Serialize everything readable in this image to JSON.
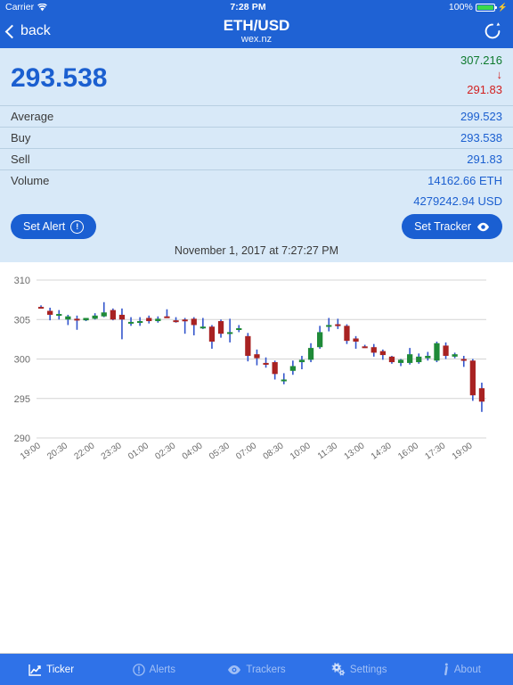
{
  "status_bar": {
    "carrier": "Carrier",
    "wifi_icon": "wifi-icon",
    "time": "7:28 PM",
    "battery_percent": "100%",
    "battery_icon": "battery-icon",
    "charging_icon": "lightning-bolt-icon"
  },
  "nav": {
    "back_label": "back",
    "back_icon": "chevron-left-icon",
    "title": "ETH/USD",
    "subtitle": "wex.nz",
    "refresh_icon": "refresh-icon"
  },
  "ticker": {
    "last_price": "293.538",
    "high": "307.216",
    "trend_icon": "arrow-down-icon",
    "low": "291.83",
    "rows": [
      {
        "label": "Average",
        "value": "299.523"
      },
      {
        "label": "Buy",
        "value": "293.538"
      },
      {
        "label": "Sell",
        "value": "291.83"
      }
    ],
    "volume_label": "Volume",
    "volume_base": "14162.66 ETH",
    "volume_quote": "4279242.94 USD",
    "set_alert_label": "Set Alert",
    "set_alert_icon": "exclamation-circle-icon",
    "set_tracker_label": "Set Tracker",
    "set_tracker_icon": "eye-icon",
    "timestamp": "November 1, 2017 at 7:27:27 PM"
  },
  "colors": {
    "brand_blue": "#1f62d4",
    "tabbar_blue": "#2f72e8",
    "panel_bg": "#d8e9f8",
    "price_blue": "#1b5fd0",
    "high_green": "#0e7a2e",
    "low_red": "#d21f1f",
    "candle_up": "#1f8a38",
    "candle_down": "#a82222",
    "wick_blue": "#3355cc",
    "gridline": "#d4d4d4"
  },
  "chart_data": {
    "type": "candlestick",
    "title": "",
    "xlabel": "",
    "ylabel": "",
    "ylim": [
      290,
      310
    ],
    "yticks": [
      290,
      295,
      300,
      305,
      310
    ],
    "grid": true,
    "legend": "none",
    "xticks": [
      "19:00",
      "20:30",
      "22:00",
      "23:30",
      "01:00",
      "02:30",
      "04:00",
      "05:30",
      "07:00",
      "08:30",
      "10:00",
      "11:30",
      "13:00",
      "14:30",
      "16:00",
      "17:30",
      "19:00"
    ],
    "xtick_every_n_candles": 3,
    "candles": [
      {
        "t": "19:00",
        "o": 306.6,
        "h": 306.8,
        "l": 306.4,
        "c": 306.5,
        "dir": "down"
      },
      {
        "t": "19:30",
        "o": 306.1,
        "h": 306.5,
        "l": 304.9,
        "c": 305.6,
        "dir": "down"
      },
      {
        "t": "20:00",
        "o": 305.5,
        "h": 306.2,
        "l": 305.0,
        "c": 305.7,
        "dir": "up"
      },
      {
        "t": "20:30",
        "o": 305.4,
        "h": 305.6,
        "l": 304.3,
        "c": 305.0,
        "dir": "up"
      },
      {
        "t": "21:00",
        "o": 305.1,
        "h": 305.5,
        "l": 303.7,
        "c": 304.9,
        "dir": "down"
      },
      {
        "t": "21:30",
        "o": 304.9,
        "h": 305.2,
        "l": 304.8,
        "c": 305.2,
        "dir": "up"
      },
      {
        "t": "22:00",
        "o": 305.1,
        "h": 305.8,
        "l": 305.0,
        "c": 305.5,
        "dir": "up"
      },
      {
        "t": "22:30",
        "o": 305.4,
        "h": 307.2,
        "l": 305.3,
        "c": 305.9,
        "dir": "up"
      },
      {
        "t": "23:00",
        "o": 306.2,
        "h": 306.4,
        "l": 304.9,
        "c": 305.0,
        "dir": "down"
      },
      {
        "t": "23:30",
        "o": 305.6,
        "h": 306.4,
        "l": 302.5,
        "c": 305.0,
        "dir": "down"
      },
      {
        "t": "00:00",
        "o": 304.7,
        "h": 305.3,
        "l": 304.2,
        "c": 304.6,
        "dir": "up"
      },
      {
        "t": "00:30",
        "o": 304.7,
        "h": 305.3,
        "l": 304.2,
        "c": 304.8,
        "dir": "up"
      },
      {
        "t": "01:00",
        "o": 305.2,
        "h": 305.5,
        "l": 304.5,
        "c": 304.8,
        "dir": "down"
      },
      {
        "t": "01:30",
        "o": 304.8,
        "h": 305.4,
        "l": 304.6,
        "c": 305.1,
        "dir": "up"
      },
      {
        "t": "02:00",
        "o": 305.3,
        "h": 306.3,
        "l": 305.2,
        "c": 305.4,
        "dir": "down"
      },
      {
        "t": "02:30",
        "o": 304.9,
        "h": 305.3,
        "l": 304.6,
        "c": 304.8,
        "dir": "down"
      },
      {
        "t": "03:00",
        "o": 304.9,
        "h": 305.2,
        "l": 303.2,
        "c": 305.0,
        "dir": "down"
      },
      {
        "t": "03:30",
        "o": 305.1,
        "h": 305.3,
        "l": 303.0,
        "c": 304.3,
        "dir": "down"
      },
      {
        "t": "04:00",
        "o": 304.0,
        "h": 305.2,
        "l": 303.8,
        "c": 304.1,
        "dir": "up"
      },
      {
        "t": "04:30",
        "o": 304.1,
        "h": 304.3,
        "l": 301.3,
        "c": 302.2,
        "dir": "down"
      },
      {
        "t": "05:00",
        "o": 304.8,
        "h": 305.0,
        "l": 302.7,
        "c": 303.2,
        "dir": "down"
      },
      {
        "t": "05:30",
        "o": 303.4,
        "h": 305.1,
        "l": 302.1,
        "c": 303.2,
        "dir": "up"
      },
      {
        "t": "06:00",
        "o": 303.8,
        "h": 304.3,
        "l": 303.4,
        "c": 303.9,
        "dir": "up"
      },
      {
        "t": "06:30",
        "o": 302.9,
        "h": 303.3,
        "l": 299.7,
        "c": 300.4,
        "dir": "down"
      },
      {
        "t": "07:00",
        "o": 300.6,
        "h": 301.2,
        "l": 299.2,
        "c": 300.1,
        "dir": "down"
      },
      {
        "t": "07:30",
        "o": 299.5,
        "h": 300.2,
        "l": 298.9,
        "c": 299.5,
        "dir": "down"
      },
      {
        "t": "08:00",
        "o": 299.6,
        "h": 299.8,
        "l": 297.4,
        "c": 298.1,
        "dir": "down"
      },
      {
        "t": "08:30",
        "o": 297.4,
        "h": 298.2,
        "l": 296.8,
        "c": 297.2,
        "dir": "up"
      },
      {
        "t": "09:00",
        "o": 298.5,
        "h": 299.8,
        "l": 298.0,
        "c": 299.1,
        "dir": "up"
      },
      {
        "t": "09:30",
        "o": 299.6,
        "h": 300.4,
        "l": 298.7,
        "c": 299.9,
        "dir": "up"
      },
      {
        "t": "10:00",
        "o": 299.9,
        "h": 302.0,
        "l": 299.6,
        "c": 301.4,
        "dir": "up"
      },
      {
        "t": "10:30",
        "o": 301.5,
        "h": 304.2,
        "l": 301.3,
        "c": 303.4,
        "dir": "up"
      },
      {
        "t": "11:00",
        "o": 304.2,
        "h": 305.2,
        "l": 303.5,
        "c": 304.3,
        "dir": "up"
      },
      {
        "t": "11:30",
        "o": 304.4,
        "h": 305.1,
        "l": 303.8,
        "c": 304.3,
        "dir": "down"
      },
      {
        "t": "12:00",
        "o": 304.2,
        "h": 304.4,
        "l": 301.9,
        "c": 302.3,
        "dir": "down"
      },
      {
        "t": "12:30",
        "o": 302.6,
        "h": 302.9,
        "l": 301.3,
        "c": 302.2,
        "dir": "down"
      },
      {
        "t": "13:00",
        "o": 301.6,
        "h": 301.8,
        "l": 301.4,
        "c": 301.6,
        "dir": "down"
      },
      {
        "t": "13:30",
        "o": 301.5,
        "h": 301.9,
        "l": 300.3,
        "c": 300.8,
        "dir": "down"
      },
      {
        "t": "14:00",
        "o": 301.0,
        "h": 301.2,
        "l": 299.9,
        "c": 300.5,
        "dir": "down"
      },
      {
        "t": "14:30",
        "o": 300.3,
        "h": 300.4,
        "l": 299.4,
        "c": 299.6,
        "dir": "down"
      },
      {
        "t": "15:00",
        "o": 299.5,
        "h": 300.0,
        "l": 299.1,
        "c": 299.9,
        "dir": "up"
      },
      {
        "t": "15:30",
        "o": 299.5,
        "h": 301.4,
        "l": 299.3,
        "c": 300.6,
        "dir": "up"
      },
      {
        "t": "16:00",
        "o": 299.6,
        "h": 300.7,
        "l": 299.4,
        "c": 300.3,
        "dir": "up"
      },
      {
        "t": "16:30",
        "o": 300.1,
        "h": 300.9,
        "l": 299.8,
        "c": 300.4,
        "dir": "up"
      },
      {
        "t": "17:00",
        "o": 299.8,
        "h": 302.2,
        "l": 299.6,
        "c": 302.0,
        "dir": "up"
      },
      {
        "t": "17:30",
        "o": 301.7,
        "h": 302.1,
        "l": 300.0,
        "c": 300.4,
        "dir": "down"
      },
      {
        "t": "18:00",
        "o": 300.3,
        "h": 300.8,
        "l": 300.1,
        "c": 300.6,
        "dir": "up"
      },
      {
        "t": "18:30",
        "o": 300.0,
        "h": 300.4,
        "l": 299.0,
        "c": 299.8,
        "dir": "down"
      },
      {
        "t": "19:00",
        "o": 299.8,
        "h": 300.0,
        "l": 294.7,
        "c": 295.4,
        "dir": "down"
      },
      {
        "t": "19:30",
        "o": 296.3,
        "h": 297.0,
        "l": 293.3,
        "c": 294.6,
        "dir": "down"
      }
    ]
  },
  "tabbar": {
    "items": [
      {
        "label": "Ticker",
        "icon": "chart-line-icon",
        "active": true
      },
      {
        "label": "Alerts",
        "icon": "exclamation-circle-icon",
        "active": false
      },
      {
        "label": "Trackers",
        "icon": "eye-icon",
        "active": false
      },
      {
        "label": "Settings",
        "icon": "gears-icon",
        "active": false
      },
      {
        "label": "About",
        "icon": "info-icon",
        "active": false
      }
    ]
  }
}
